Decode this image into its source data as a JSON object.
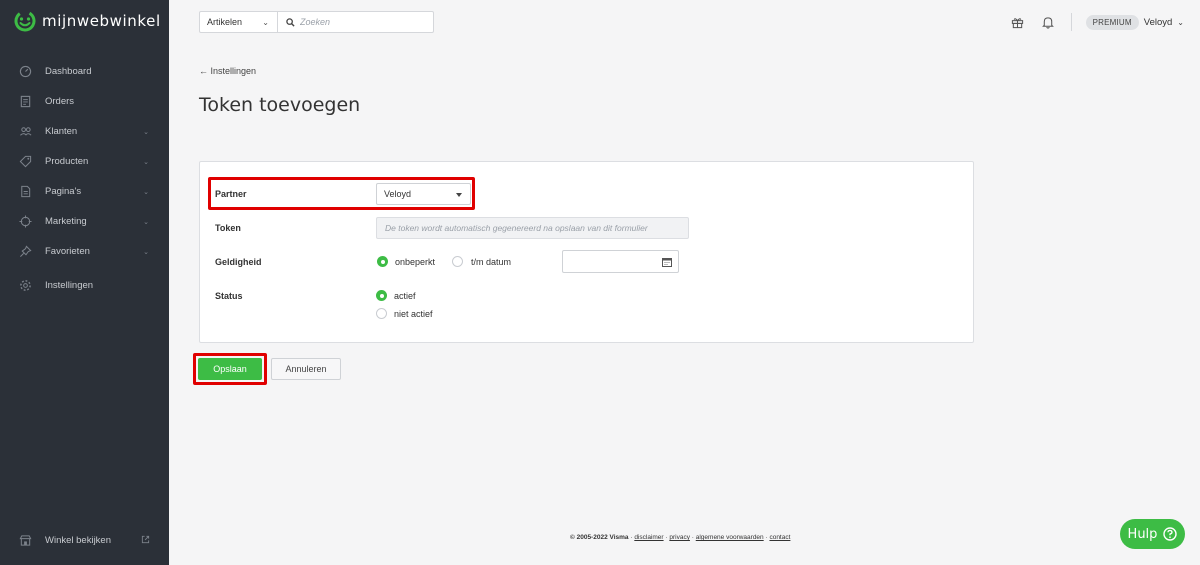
{
  "brand": {
    "name": "mijnwebwinkel"
  },
  "sidebar": {
    "items": [
      {
        "label": "Dashboard",
        "icon": "dashboard-icon",
        "chevron": false
      },
      {
        "label": "Orders",
        "icon": "orders-icon",
        "chevron": false
      },
      {
        "label": "Klanten",
        "icon": "customers-icon",
        "chevron": true
      },
      {
        "label": "Producten",
        "icon": "tag-icon",
        "chevron": true
      },
      {
        "label": "Pagina's",
        "icon": "page-icon",
        "chevron": true
      },
      {
        "label": "Marketing",
        "icon": "target-icon",
        "chevron": true
      },
      {
        "label": "Favorieten",
        "icon": "pin-icon",
        "chevron": true
      },
      {
        "label": "Instellingen",
        "icon": "gear-icon",
        "chevron": false
      }
    ],
    "bottom": {
      "label": "Winkel bekijken",
      "icon": "store-icon"
    }
  },
  "topbar": {
    "search_category": "Artikelen",
    "search_placeholder": "Zoeken",
    "plan_badge": "PREMIUM",
    "user_name": "Veloyd"
  },
  "page": {
    "back_label": "← Instellingen",
    "title": "Token toevoegen"
  },
  "form": {
    "partner": {
      "label": "Partner",
      "value": "Veloyd"
    },
    "token": {
      "label": "Token",
      "placeholder": "De token wordt automatisch gegenereerd na opslaan van dit formulier"
    },
    "validity": {
      "label": "Geldigheid",
      "option_unlimited": "onbeperkt",
      "option_until": "t/m datum",
      "selected": "onbeperkt"
    },
    "status": {
      "label": "Status",
      "option_active": "actief",
      "option_inactive": "niet actief",
      "selected": "actief"
    }
  },
  "actions": {
    "save": "Opslaan",
    "cancel": "Annuleren"
  },
  "footer": {
    "copyright": "© 2005-2022 Visma",
    "links": [
      "disclaimer",
      "privacy",
      "algemene voorwaarden",
      "contact"
    ]
  },
  "help": {
    "label": "Hulp"
  },
  "colors": {
    "sidebar_bg": "#2b3038",
    "accent_green": "#3dbc45",
    "highlight_red": "#e00000"
  }
}
